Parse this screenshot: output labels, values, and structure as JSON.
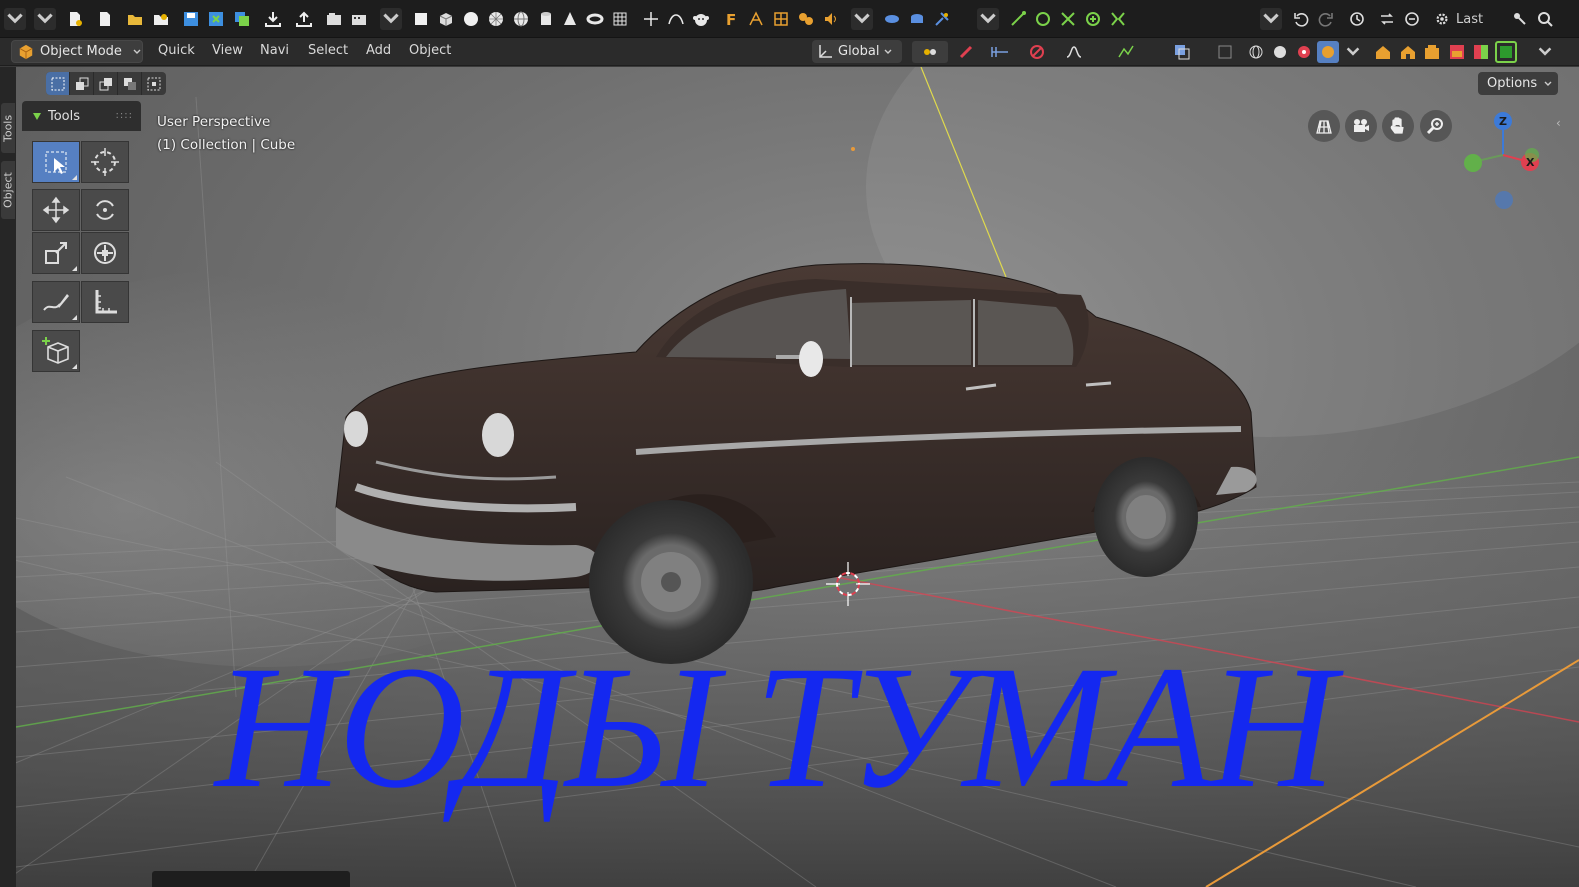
{
  "topbar": {
    "last_label": "Last",
    "icons": [
      "menu-dropdown-icon",
      "file-dropdown-icon",
      "new-file-icon",
      "new-blank-icon",
      "open-folder-icon",
      "open-recent-icon",
      "save-icon",
      "save-as-icon",
      "save-copy-icon",
      "import-icon",
      "export-icon",
      "render-image-icon",
      "render-animation-icon",
      "more-dropdown-icon",
      "add-plane-icon",
      "add-cube-icon",
      "add-sphere-icon",
      "add-icosphere-icon",
      "add-uvsphere-icon",
      "add-cylinder-icon",
      "add-cone-icon",
      "add-torus-icon",
      "add-grid-icon",
      "add-empty-icon",
      "add-curve-icon",
      "add-monkey-icon",
      "add-text-icon",
      "add-armature-icon",
      "add-lattice-icon",
      "add-metaball-icon",
      "add-speaker-icon",
      "more-dropdown-icon",
      "add-light-icon",
      "add-camera-icon",
      "add-force-icon",
      "more-dropdown-icon",
      "snap-icon",
      "transform-icon",
      "scale-icon",
      "rotate-icon",
      "mirror-icon",
      "undo-icon",
      "redo-icon",
      "undo-history-icon",
      "repeat-icon",
      "repeat-history-icon",
      "preferences-icon",
      "search-icon"
    ]
  },
  "header": {
    "mode_label": "Object Mode",
    "menus": [
      "Quick",
      "View",
      "Navi",
      "Select",
      "Add",
      "Object"
    ],
    "orientation_label": "Global"
  },
  "side_tabs": {
    "tools": "Tools",
    "object": "Object"
  },
  "tools_panel": {
    "title": "Tools",
    "tools": [
      {
        "name": "select-box-tool",
        "active": true
      },
      {
        "name": "cursor-tool",
        "active": false
      },
      {
        "name": "move-tool",
        "active": false
      },
      {
        "name": "rotate-tool",
        "active": false
      },
      {
        "name": "scale-tool",
        "active": false
      },
      {
        "name": "transform-tool",
        "active": false
      },
      {
        "name": "annotate-tool",
        "active": false
      },
      {
        "name": "measure-tool",
        "active": false
      },
      {
        "name": "add-cube-tool",
        "active": false
      }
    ]
  },
  "viewport": {
    "view_name": "User Perspective",
    "collection_line": "(1) Collection | Cube",
    "options_label": "Options",
    "gizmo": {
      "x": "X",
      "z": "Z"
    },
    "overlay_caption": "НОДЫ ТУМАН"
  },
  "colors": {
    "accent": "#5680c2",
    "caption": "#1428f0",
    "axis_x": "#e04050",
    "axis_y": "#62b04a",
    "axis_z": "#3c7ad8"
  }
}
